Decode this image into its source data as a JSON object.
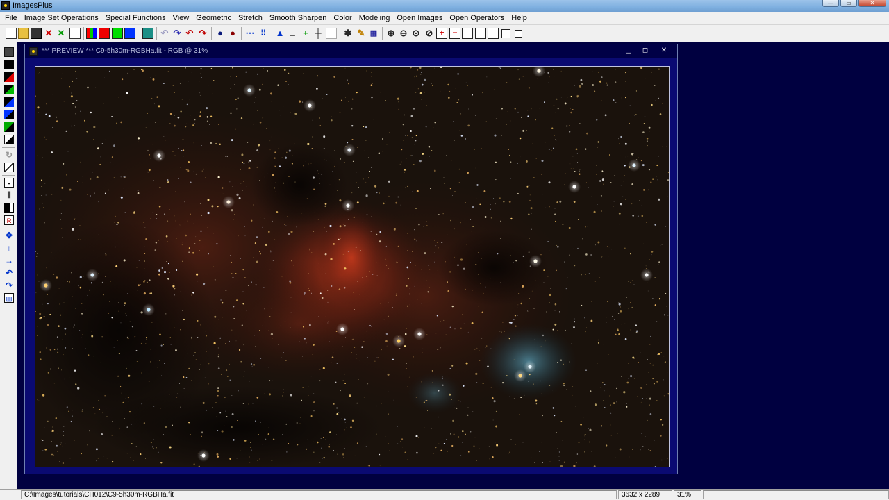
{
  "app": {
    "title": "ImagesPlus"
  },
  "window_controls": {
    "minimize": "—",
    "maximize": "▭",
    "close": "✕"
  },
  "menu": [
    "File",
    "Image Set Operations",
    "Special Functions",
    "View",
    "Geometric",
    "Stretch",
    "Smooth Sharpen",
    "Color",
    "Modeling",
    "Open Images",
    "Open Operators",
    "Help"
  ],
  "preview": {
    "caption": "*** PREVIEW *** C9-5h30m-RGBHa.fit - RGB @ 31%",
    "minimize": "▁",
    "maximize": "◻",
    "close": "✕"
  },
  "status": {
    "path": "C:\\Images\\tutorials\\CH012\\C9-5h30m-RGBHa.fit",
    "dimensions": "3632 x 2289",
    "zoom": "31%"
  },
  "colors": {
    "workspace": "#000040",
    "preview_frame": "#0a0a72",
    "nebula": "#b8341a",
    "reflection_nebula": "#4a8aa0"
  },
  "icons": {
    "toolbar": [
      "new-icon",
      "open-icon",
      "save-icon",
      "close-red-x-icon",
      "close-green-x-icon",
      "copy-icon",
      "rgb-channels-icon",
      "red-channel-icon",
      "green-channel-icon",
      "blue-channel-icon",
      "teal-image-icon",
      "undo-icon",
      "redo-icon",
      "undo-red-icon",
      "redo-red-icon",
      "circle-blue-icon",
      "circle-red-icon",
      "dotted-line-icon",
      "dotted-arrow-icon",
      "histogram-icon",
      "levels-icon",
      "plus-icon",
      "crosshair-icon",
      "grid-icon",
      "pencil-icon",
      "star-icon",
      "table-icon",
      "zoom-in-icon",
      "zoom-out-icon",
      "zoom-fit-icon",
      "zoom-100-icon",
      "add-red-icon",
      "minus-red-icon",
      "frame-1-icon",
      "frame-2-icon",
      "frame-3-icon",
      "frame-4-icon",
      "frame-5-icon"
    ],
    "left": [
      "save-icon",
      "black-square-icon",
      "red-square-icon",
      "green-square-icon",
      "blue-square-icon",
      "black-blue-square-icon",
      "black-green-square-icon",
      "black-white-square-icon",
      "rotate-icon",
      "diagonal-icon",
      "target-square-icon",
      "bars-icon",
      "black-bar-icon",
      "red-r-icon",
      "move-icon",
      "arrow-up-icon",
      "arrow-right-icon",
      "rotate-left-icon",
      "rotate-right-icon",
      "crop-icon"
    ]
  }
}
